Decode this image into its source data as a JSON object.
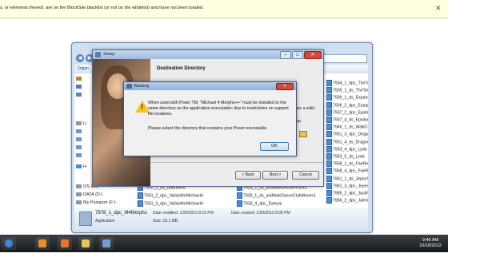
{
  "infobar": {
    "text": "s, or elements thereof, are on the BlockSite blacklist (or not on the whitelist) and have not been loaded.",
    "close_label": "✕"
  },
  "explorer": {
    "nav_back": "◀",
    "nav_forward": "▶",
    "search_placeholder": "Search",
    "organize_label": "Organ",
    "nav_items": [
      {
        "label": "Li"
      },
      {
        "label": "H"
      },
      {
        "label": "OS (C:)"
      },
      {
        "label": "DATA (D:)"
      },
      {
        "label": "My Passport (F:)"
      }
    ],
    "files_col1": [
      "7910_2_ds_Dauntless",
      "7931_2_dpc_ValiantforMichael4",
      "7931_3_dpc_ValiantforMichael4"
    ],
    "files_col2": [
      "7925_1_ds_aniMateGesturePack1",
      "7926_1_ds_aniMateDanceClubMoves1",
      "7933_4_dpc_Eweyai"
    ],
    "files_col3": [
      "7934_1_dpc_TheTave",
      "7935_1_ds_TheTavern",
      "7936_1_ds_Expansion",
      "7936_2_dpc_Expansio",
      "7937_2_dpc_Epsilonfo",
      "7937_4_ds_Epsilonfor",
      "7946_1_ds_WalkCons",
      "7951_3_dpc_Dragons",
      "7951_4_ds_Dragonsfl",
      "7953_4_dpc_Lyda",
      "7953_5_ds_Lyda",
      "7958_1_ds_FaeRealm",
      "7958_4_dpc_FaeRealm",
      "7961_1_ds_JepesSang",
      "7961_3_dpc_JepesSan",
      "7965_2_dpc_JackPum",
      "7966_2_dpc_JaiHair"
    ],
    "details": {
      "name": "7878_1_dpc_M4Morphs",
      "type": "Application",
      "modified": "Date modified: 1/20/2012 8:10 PM",
      "created": "Date created: 1/20/2012 8:09 PM",
      "size": "Size: 19.1 MB"
    }
  },
  "setup": {
    "title": "Setup",
    "heading": "Destination Directory",
    "side_text_1": "ype a valid",
    "side_text_2": "tup.",
    "back_label": "< Back",
    "next_label": "Next >",
    "cancel_label": "Cancel",
    "minimize_label": "–",
    "maximize_label": "□",
    "close_label": "✕"
  },
  "warning": {
    "title": "Warning",
    "message": "When used with Poser TM, \"Michael 4 Morphs++\" must be installed to the same directory as the application executable; due to restrictions on support file locations.",
    "message2": "Please select the directory that contains your Poser executable.",
    "ok_label": "OK",
    "close_label": "✕"
  },
  "taskbar": {
    "time": "9:46 AM",
    "date": "10/18/2012",
    "icons": [
      {
        "name": "start-orb-icon",
        "color": "#3b8ad9"
      },
      {
        "name": "media-player-icon",
        "color": "#e0912a"
      },
      {
        "name": "firefox-icon",
        "color": "#e8742a"
      },
      {
        "name": "folder-icon",
        "color": "#e8c35a"
      },
      {
        "name": "setup-app-icon",
        "color": "#6f9fd0"
      }
    ]
  }
}
